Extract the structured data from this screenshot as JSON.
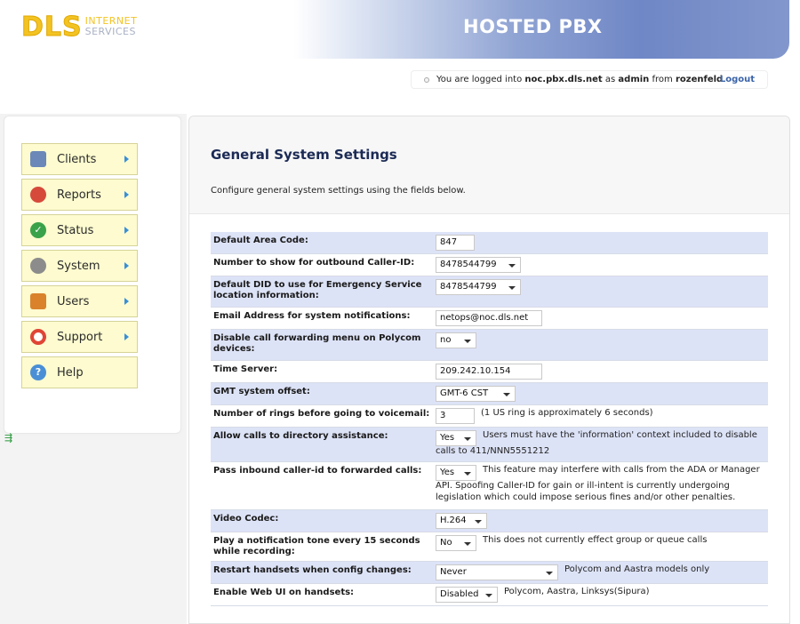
{
  "header": {
    "logo": {
      "letters": "DLS",
      "line1": "INTERNET",
      "line2": "SERVICES"
    },
    "banner_title": "HOSTED PBX"
  },
  "login": {
    "prefix": "You are logged into",
    "host": "noc.pbx.dls.net",
    "as": "as",
    "user": "admin",
    "from": "from",
    "location": "rozenfeld",
    "logout": "Logout"
  },
  "sidebar": {
    "items": [
      {
        "label": "Clients",
        "icon": "monitor-icon",
        "has_arrow": true,
        "color": "#6b88b8"
      },
      {
        "label": "Reports",
        "icon": "pie-chart-icon",
        "has_arrow": true,
        "color": "#d64a3b"
      },
      {
        "label": "Status",
        "icon": "check-circle-icon",
        "has_arrow": true,
        "color": "#3aa24a"
      },
      {
        "label": "System",
        "icon": "gears-icon",
        "has_arrow": true,
        "color": "#8c8c8c"
      },
      {
        "label": "Users",
        "icon": "users-icon",
        "has_arrow": true,
        "color": "#d9822b"
      },
      {
        "label": "Support",
        "icon": "lifebuoy-icon",
        "has_arrow": true,
        "color": "#e04535"
      },
      {
        "label": "Help",
        "icon": "help-icon",
        "has_arrow": false,
        "color": "#4a8fd6"
      }
    ]
  },
  "main": {
    "title": "General System Settings",
    "description": "Configure general system settings using the fields below.",
    "settings": [
      {
        "label": "Default Area Code:",
        "control": "text",
        "value": "847"
      },
      {
        "label": "Number to show for outbound Caller-ID:",
        "control": "select",
        "value": "8478544799"
      },
      {
        "label": "Default DID to use for Emergency Service location information:",
        "control": "select",
        "value": "8478544799"
      },
      {
        "label": "Email Address for system notifications:",
        "control": "text",
        "value": "netops@noc.dls.net"
      },
      {
        "label": "Disable call forwarding menu on Polycom devices:",
        "control": "select",
        "value": "no"
      },
      {
        "label": "Time Server:",
        "control": "text",
        "value": "209.242.10.154"
      },
      {
        "label": "GMT system offset:",
        "control": "select",
        "value": "GMT-6 CST"
      },
      {
        "label": "Number of rings before going to voicemail:",
        "control": "text",
        "value": "3",
        "note": "(1 US ring is approximately 6 seconds)"
      },
      {
        "label": "Allow calls to directory assistance:",
        "control": "select",
        "value": "Yes",
        "note": "Users must have the 'information' context included to disable calls to 411/NNN5551212"
      },
      {
        "label": "Pass inbound caller-id to forwarded calls:",
        "control": "select",
        "value": "Yes",
        "note": "This feature may interfere with calls from the ADA or Manager API. Spoofing Caller-ID for gain or ill-intent is currently undergoing legislation which could impose serious fines and/or other penalties."
      },
      {
        "label": "Video Codec:",
        "control": "select",
        "value": "H.264"
      },
      {
        "label": "Play a notification tone every 15 seconds while recording:",
        "control": "select",
        "value": "No",
        "note": "This does not currently effect group or queue calls"
      },
      {
        "label": "Restart handsets when config changes:",
        "control": "select",
        "value": "Never",
        "note": "Polycom and Aastra models only"
      },
      {
        "label": "Enable Web UI on handsets:",
        "control": "select",
        "value": "Disabled",
        "note": "Polycom, Aastra, Linksys(Sipura)"
      }
    ]
  }
}
